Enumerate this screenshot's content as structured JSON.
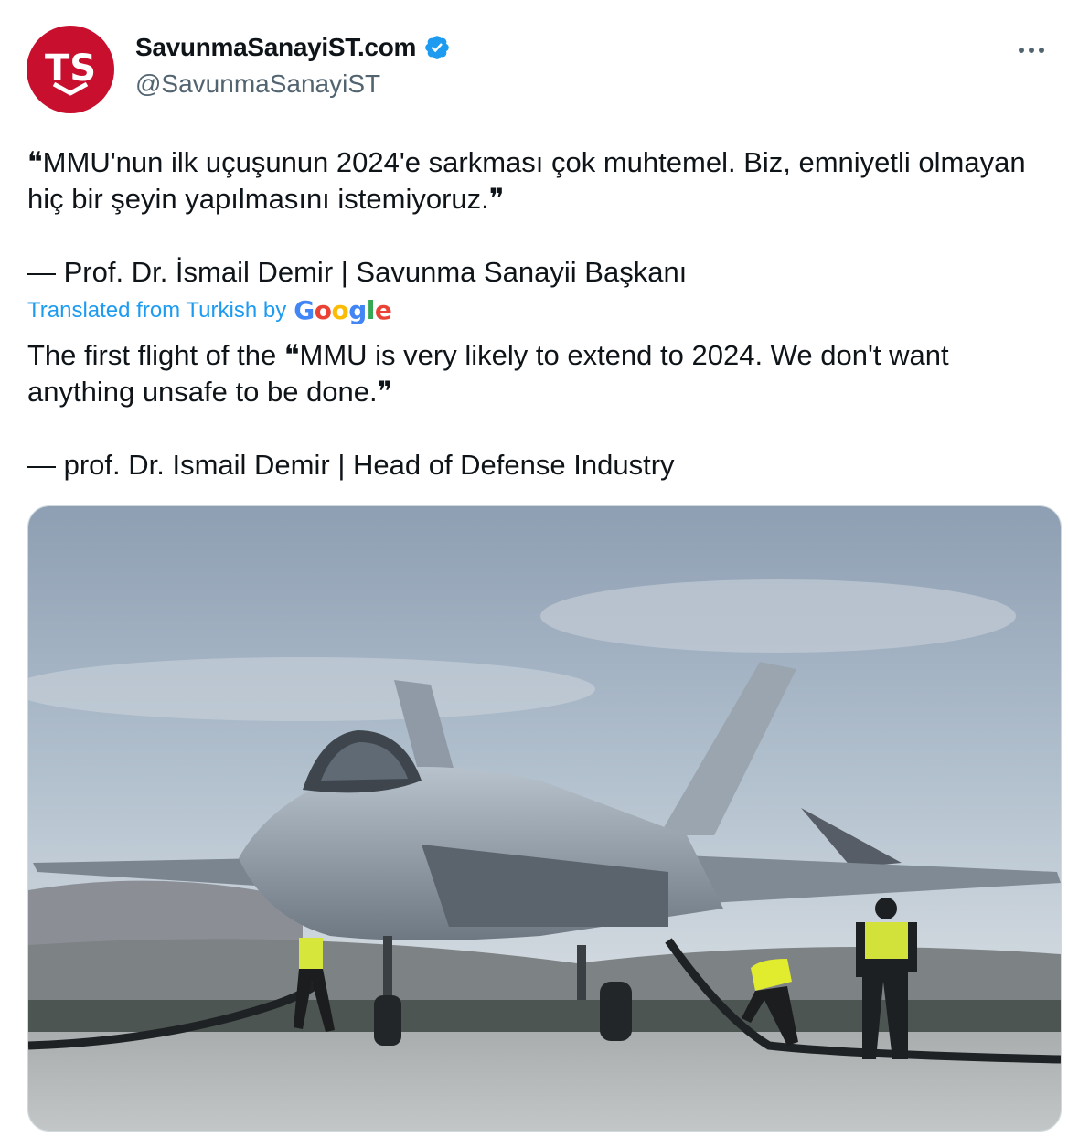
{
  "tweet": {
    "author": {
      "display_name": "SavunmaSanayiST.com",
      "handle": "@SavunmaSanayiST",
      "avatar_icon": "ts-shield-logo",
      "verified": true,
      "brand_color": "#c8102e"
    },
    "original_text": "❝MMU'nun ilk uçuşunun 2024'e sarkması çok muhtemel. Biz, emniyetli olmayan hiç bir şeyin yapılmasını istemiyoruz.❞\n\n— Prof. Dr. İsmail Demir | Savunma Sanayii Başkanı",
    "translation": {
      "label": "Translated from Turkish by",
      "provider": "Google"
    },
    "translated_text": "The first flight of the ❝MMU is very likely to extend to 2024. We don't want anything unsafe to be done.❞\n\n— prof. Dr. Ismail Demir | Head of Defense Industry",
    "media": {
      "type": "photo",
      "icon": "fighter-jet-photo"
    }
  },
  "colors": {
    "accent": "#1d9bf0",
    "text": "#0f1419",
    "secondary": "#536471"
  }
}
